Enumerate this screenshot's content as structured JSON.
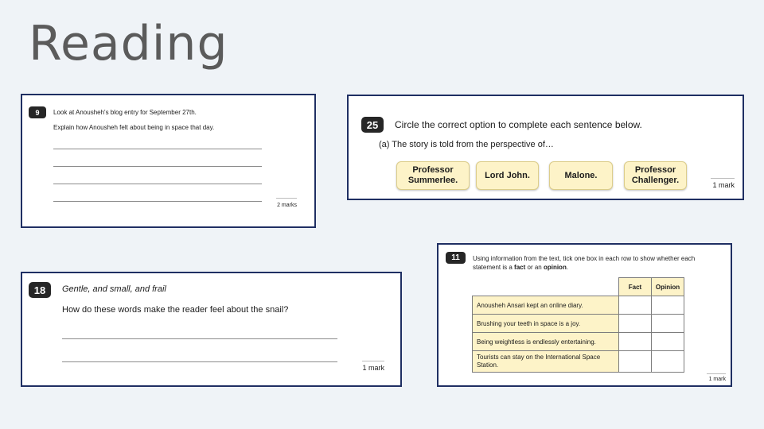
{
  "slide": {
    "title": "Reading"
  },
  "q9": {
    "number": "9",
    "prompt": "Look at Anousheh's blog entry for September 27th.",
    "instruction": "Explain how Anousheh felt about being in space that day.",
    "marks": "2 marks"
  },
  "q25": {
    "number": "25",
    "prompt": "Circle the correct option to complete each sentence below.",
    "part": "(a)  The story is told from the perspective of…",
    "options": [
      "Professor Summerlee.",
      "Lord John.",
      "Malone.",
      "Professor Challenger."
    ],
    "marks": "1 mark"
  },
  "q18": {
    "number": "18",
    "quote": "Gentle, and small, and frail",
    "question": "How do these words make the reader feel about the snail?",
    "marks": "1 mark"
  },
  "q11": {
    "number": "11",
    "prompt_start": "Using information from the text, tick one box in each row to show whether each statement is a ",
    "fact_word": "fact",
    "prompt_mid": " or an ",
    "opinion_word": "opinion",
    "prompt_end": ".",
    "headers": [
      "Fact",
      "Opinion"
    ],
    "statements": [
      "Anousheh Ansari kept an online diary.",
      "Brushing your teeth in space is a joy.",
      "Being weightless is endlessly entertaining.",
      "Tourists can stay on the International Space Station."
    ],
    "marks": "1 mark"
  }
}
